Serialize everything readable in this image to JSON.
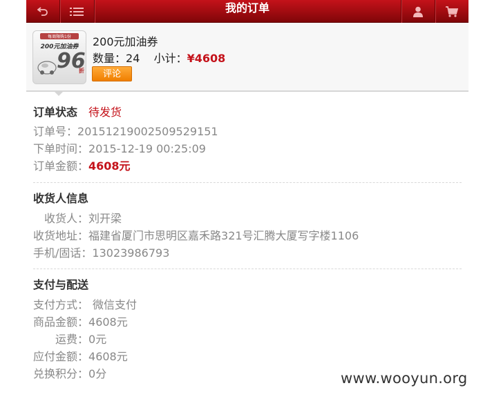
{
  "header": {
    "title": "我的订单",
    "back_icon": "back-arrow-icon",
    "menu_icon": "list-menu-icon",
    "user_icon": "user-icon",
    "cart_icon": "cart-icon",
    "bar_color": "#9e0b10"
  },
  "product": {
    "thumb_banner": "每周限购1份",
    "thumb_title": "200元加油券",
    "thumb_number": "96",
    "thumb_unit": "折",
    "name": "200元加油券",
    "qty_label": "数量：",
    "qty_value": "24",
    "subtotal_label": "小计：",
    "subtotal_value": "¥4608",
    "review_button": "评论"
  },
  "order_status": {
    "heading": "订单状态",
    "status": "待发货",
    "order_no_label": "订单号：",
    "order_no": "20151219002509529151",
    "time_label": "下单时间：",
    "time": "2015-12-19 00:25:09",
    "amount_label": "订单金额：",
    "amount": "4608元"
  },
  "receiver": {
    "heading": "收货人信息",
    "name_label": "收货人：",
    "name": "刘开梁",
    "address_label": "收货地址：",
    "address": "福建省厦门市思明区嘉禾路321号汇腾大厦写字楼1106",
    "phone_label": "手机/固话：",
    "phone": "13023986793"
  },
  "payment": {
    "heading": "支付与配送",
    "method_label": "支付方式：",
    "method": "微信支付",
    "goods_label": "商品金额：",
    "goods": "4608元",
    "shipping_label": "运费：",
    "shipping": "0元",
    "payable_label": "应付金额：",
    "payable": "4608元",
    "points_label": "兑换积分：",
    "points": "0分"
  },
  "watermark": "www.wooyun.org",
  "colors": {
    "accent_red": "#c4121a",
    "button_orange": "#f07f00"
  }
}
